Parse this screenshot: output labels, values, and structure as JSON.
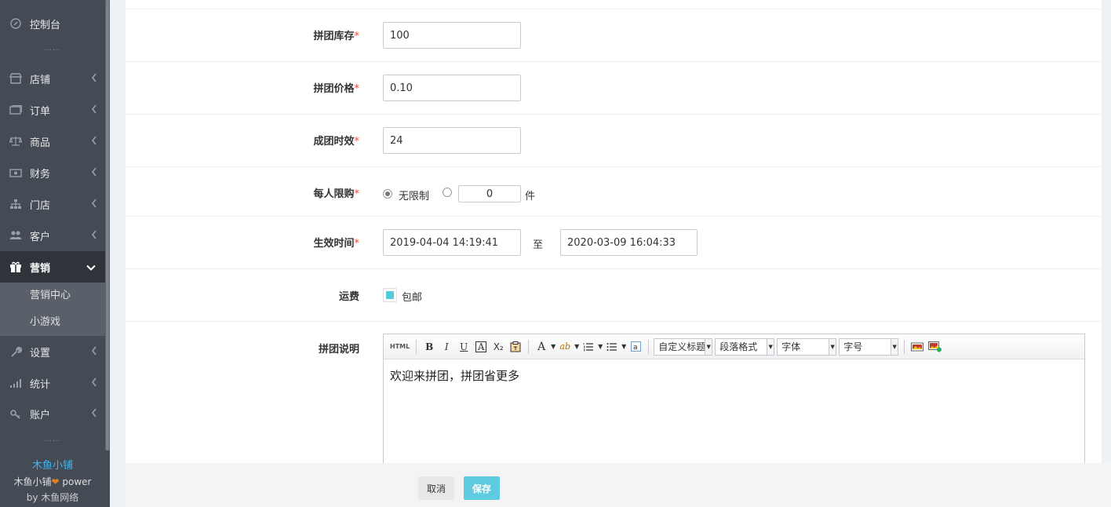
{
  "sidebar": {
    "items": [
      {
        "label": "控制台"
      },
      {
        "label": "店铺"
      },
      {
        "label": "订单"
      },
      {
        "label": "商品"
      },
      {
        "label": "财务"
      },
      {
        "label": "门店"
      },
      {
        "label": "客户"
      },
      {
        "label": "营销"
      },
      {
        "label": "设置"
      },
      {
        "label": "统计"
      },
      {
        "label": "账户"
      }
    ],
    "submenu": [
      {
        "label": "营销中心"
      },
      {
        "label": "小游戏"
      }
    ],
    "dots": "……",
    "brand": {
      "name": "木鱼小铺",
      "power_prefix": "木鱼小铺",
      "power_suffix": " power",
      "by_prefix": "by ",
      "by_name": "木鱼网络",
      "name_color": "#3fb6f0",
      "heart_color": "#e67e22"
    }
  },
  "form": {
    "stock": {
      "label": "拼团库存",
      "value": "100"
    },
    "price": {
      "label": "拼团价格",
      "value": "0.10"
    },
    "duration": {
      "label": "成团时效",
      "value": "24"
    },
    "limit": {
      "label": "每人限购",
      "option_unlimited": "无限制",
      "qty_value": "0",
      "unit": "件"
    },
    "effective": {
      "label": "生效时间",
      "start": "2019-04-04 14:19:41",
      "to": "至",
      "end": "2020-03-09 16:04:33"
    },
    "shipping": {
      "label": "运费",
      "option": "包邮"
    },
    "description": {
      "label": "拼团说明",
      "content": "欢迎来拼团，拼团省更多",
      "toolbar": {
        "html": "HTML",
        "bold": "B",
        "italic": "I",
        "underline": "U",
        "border_a": "A",
        "subscript": "X₂",
        "font_color": "A",
        "highlight": "ab",
        "custom_title": "自定义标题",
        "paragraph": "段落格式",
        "font": "字体",
        "size": "字号"
      }
    },
    "required_mark": "*"
  },
  "actions": {
    "cancel": "取消",
    "save": "保存",
    "save_color": "#5ecbe0"
  }
}
